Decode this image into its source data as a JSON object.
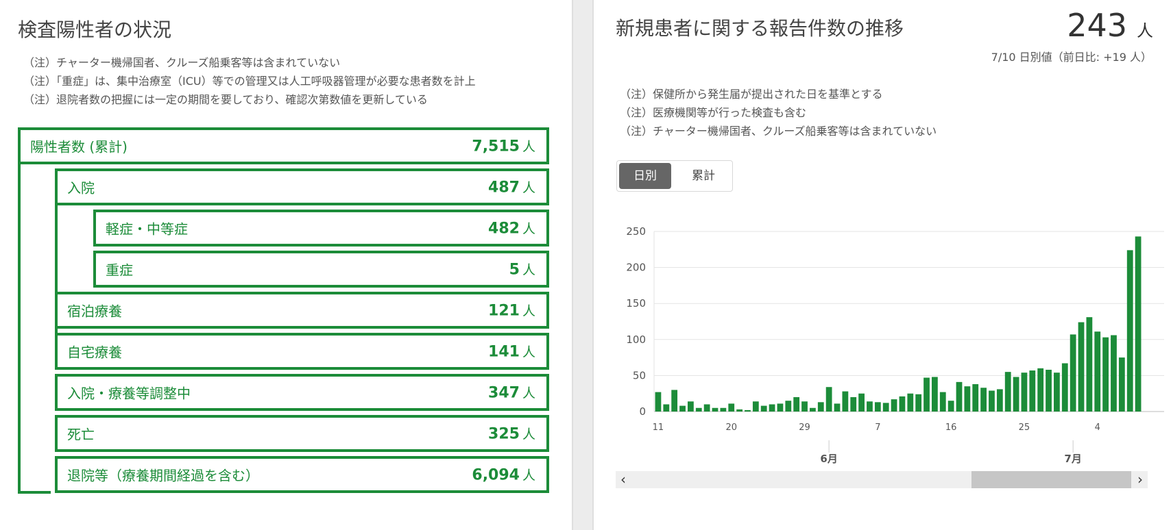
{
  "left": {
    "title": "検査陽性者の状況",
    "notes": [
      "（注）チャーター機帰国者、クルーズ船乗客等は含まれていない",
      "（注）「重症」は、集中治療室（ICU）等での管理又は人工呼吸器管理が必要な患者数を計上",
      "（注）退院者数の把握には一定の期間を要しており、確認次第数値を更新している"
    ],
    "unit": "人",
    "rows": [
      {
        "label": "陽性者数 (累計)",
        "value": "7,515"
      },
      {
        "label": "入院",
        "value": "487"
      },
      {
        "label": "軽症・中等症",
        "value": "482"
      },
      {
        "label": "重症",
        "value": "5"
      },
      {
        "label": "宿泊療養",
        "value": "121"
      },
      {
        "label": "自宅療養",
        "value": "141"
      },
      {
        "label": "入院・療養等調整中",
        "value": "347"
      },
      {
        "label": "死亡",
        "value": "325"
      },
      {
        "label": "退院等（療養期間経過を含む）",
        "value": "6,094"
      }
    ]
  },
  "right": {
    "title": "新規患者に関する報告件数の推移",
    "big_value": "243",
    "big_unit": "人",
    "subtitle": "7/10 日別値（前日比: +19 人）",
    "notes": [
      "（注）保健所から発生届が提出された日を基準とする",
      "（注）医療機関等が行った検査も含む",
      "（注）チャーター機帰国者、クルーズ船乗客等は含まれていない"
    ],
    "toggle": {
      "daily": "日別",
      "cumulative": "累計",
      "selected": "daily"
    },
    "scroll_left": "‹",
    "scroll_right": "›"
  },
  "colors": {
    "accent": "#1c8c39",
    "bar": "#1c8c39"
  },
  "chart_data": {
    "type": "bar",
    "ylim": [
      0,
      250
    ],
    "yticks": [
      0,
      50,
      100,
      150,
      200,
      250
    ],
    "x_tick_labels": [
      {
        "label": "11",
        "index": 0
      },
      {
        "label": "20",
        "index": 9
      },
      {
        "label": "29",
        "index": 18
      },
      {
        "label": "7",
        "index": 27
      },
      {
        "label": "16",
        "index": 36
      },
      {
        "label": "25",
        "index": 45
      },
      {
        "label": "4",
        "index": 54
      }
    ],
    "month_labels": [
      {
        "label": "6月",
        "index": 21
      },
      {
        "label": "7月",
        "index": 51
      }
    ],
    "values": [
      27,
      10,
      30,
      8,
      14,
      5,
      10,
      5,
      5,
      11,
      3,
      2,
      14,
      8,
      10,
      11,
      15,
      20,
      14,
      5,
      13,
      34,
      11,
      28,
      20,
      25,
      14,
      13,
      12,
      17,
      21,
      25,
      24,
      47,
      48,
      27,
      15,
      41,
      35,
      38,
      33,
      29,
      31,
      55,
      48,
      54,
      57,
      60,
      58,
      54,
      67,
      107,
      124,
      131,
      111,
      103,
      106,
      75,
      224,
      243
    ]
  }
}
